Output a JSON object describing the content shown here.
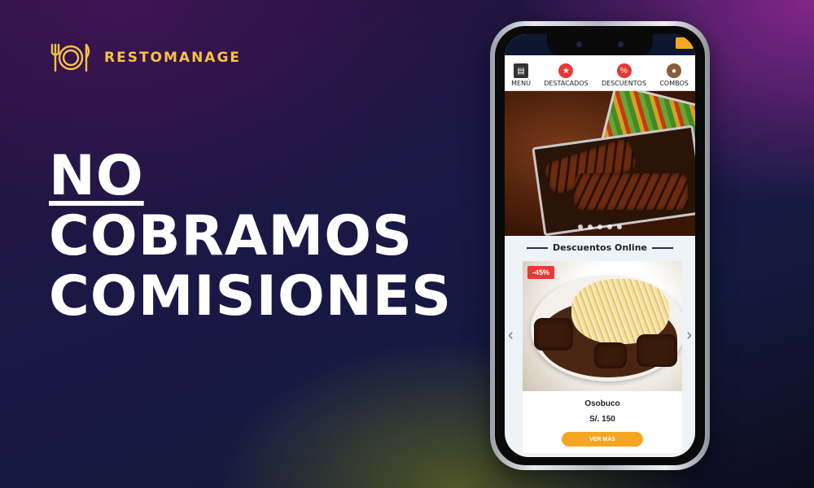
{
  "brand": {
    "name": "RESTOMANAGE",
    "icon": "plate-fork-knife-icon",
    "color": "#f6c343"
  },
  "headline": {
    "line1": "NO",
    "line2": "COBRAMOS",
    "line3": "COMISIONES"
  },
  "app": {
    "nav": [
      {
        "label": "MENÚ",
        "icon": "menu-board-icon",
        "color": "#333333"
      },
      {
        "label": "DESTACADOS",
        "icon": "star-icon",
        "color": "#e53935"
      },
      {
        "label": "DESCUENTOS",
        "icon": "percent-icon",
        "color": "#e53935"
      },
      {
        "label": "COMBOS",
        "icon": "combo-avatar-icon",
        "color": "#8a5a3a"
      }
    ],
    "hero_slide_count": 5,
    "section_title": "Descuentos Online",
    "product": {
      "discount_badge": "-45%",
      "name": "Osobuco",
      "price": "S/. 150",
      "cta": "VER MÁS"
    }
  }
}
